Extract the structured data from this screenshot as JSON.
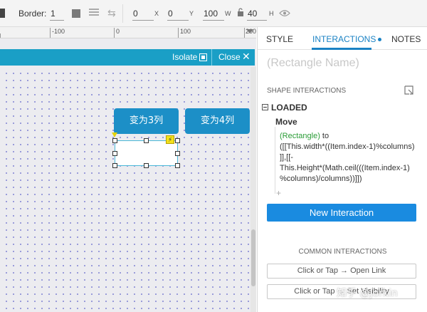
{
  "toolbar": {
    "border_label": "Border:",
    "border_value": "1",
    "x_value": "0",
    "x_label": "X",
    "y_value": "0",
    "y_label": "Y",
    "w_value": "100",
    "w_label": "W",
    "h_value": "40",
    "h_label": "H"
  },
  "ruler": {
    "labels": [
      "-100",
      "0",
      "100",
      "200"
    ]
  },
  "isolate_bar": {
    "isolate_label": "Isolate",
    "close_label": "Close"
  },
  "canvas": {
    "button_3": "变为3列",
    "button_4": "变为4列"
  },
  "panel": {
    "tabs": [
      {
        "label": "STYLE"
      },
      {
        "label": "INTERACTIONS"
      },
      {
        "label": "NOTES"
      }
    ],
    "rect_name_placeholder": "(Rectangle Name)",
    "shape_interactions_label": "SHAPE INTERACTIONS",
    "event_label": "LOADED",
    "action_label": "Move",
    "target": "(Rectangle)",
    "target_suffix": " to",
    "code_line1": "([[This.width*((Item.index-1)%columns)",
    "code_line2": "]],[[-",
    "code_line3": "This.Height*(Math.ceil(((Item.index-1)",
    "code_line4": "%columns)/columns))]])",
    "plus": "+",
    "new_interaction_label": "New Interaction",
    "common_interactions_label": "COMMON INTERACTIONS",
    "common_options": [
      "Click or Tap → Open Link",
      "Click or Tap → Set Visibility"
    ]
  },
  "watermark": "知乎 @Jorkin",
  "colors": {
    "accent": "#1a82c4",
    "isolate_bar": "#1a9fc6",
    "canvas_button": "#1c8fc7",
    "new_button": "#1a8be0",
    "code_target": "#2a9c36"
  }
}
